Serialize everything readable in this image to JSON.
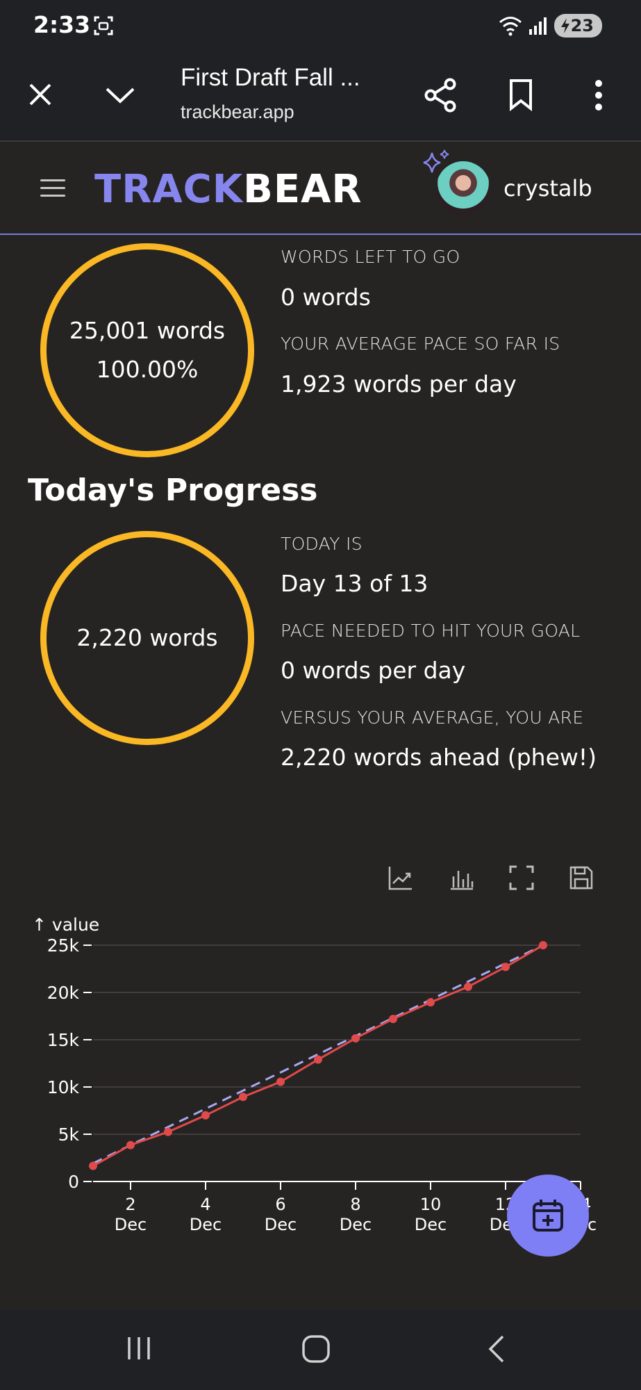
{
  "status_bar": {
    "time": "2:33",
    "battery": "23"
  },
  "browser": {
    "title": "First Draft Fall ...",
    "url": "trackbear.app"
  },
  "app": {
    "logo_part1": "TRACK",
    "logo_part2": "BEAR",
    "username": "crystalb"
  },
  "overall": {
    "ring_line1": "25,001 words",
    "ring_line2": "100.00%",
    "label1": "WORDS LEFT TO GO",
    "value1": "0 words",
    "label2": "YOUR AVERAGE PACE SO FAR IS",
    "value2": "1,923 words per day"
  },
  "today": {
    "title": "Today's Progress",
    "ring": "2,220 words",
    "label1": "TODAY IS",
    "value1": "Day 13 of 13",
    "label2": "PACE NEEDED TO HIT YOUR GOAL",
    "value2": "0 words per day",
    "label3": "VERSUS YOUR AVERAGE, YOU ARE",
    "value3": "2,220 words ahead (phew!)"
  },
  "chart_toolbar": [
    "line-chart-icon",
    "bar-chart-icon",
    "fullscreen-icon",
    "save-icon"
  ],
  "colors": {
    "accent": "#8686ee",
    "ring": "#fbb825",
    "actual_line": "#e04a4a",
    "target_line": "#a8a8f0",
    "fab": "#7f7ff5"
  },
  "chart_data": {
    "type": "line",
    "ylabel": "↑ value",
    "yticks": [
      "0",
      "5k",
      "10k",
      "15k",
      "20k",
      "25k"
    ],
    "ylim": [
      0,
      25000
    ],
    "xlim": [
      1,
      14
    ],
    "xticks": [
      {
        "x": 2,
        "top": "2",
        "bottom": "Dec"
      },
      {
        "x": 4,
        "top": "4",
        "bottom": "Dec"
      },
      {
        "x": 6,
        "top": "6",
        "bottom": "Dec"
      },
      {
        "x": 8,
        "top": "8",
        "bottom": "Dec"
      },
      {
        "x": 10,
        "top": "10",
        "bottom": "Dec"
      },
      {
        "x": 12,
        "top": "12",
        "bottom": "Dec"
      },
      {
        "x": 14,
        "top": "14",
        "bottom": "Dec"
      }
    ],
    "grid": true,
    "series": [
      {
        "x": [
          1,
          2,
          3,
          4,
          5,
          6,
          7,
          8,
          9,
          10,
          11,
          12,
          13
        ],
        "values": [
          1650,
          3850,
          5250,
          7000,
          8950,
          10550,
          12900,
          15150,
          17200,
          18950,
          20600,
          22700,
          25001
        ],
        "color": "#e04a4a",
        "style": "solid",
        "markers": true
      },
      {
        "x": [
          1,
          13
        ],
        "values": [
          1923,
          25000
        ],
        "color": "#a8a8f0",
        "style": "dashed",
        "markers": false
      }
    ]
  }
}
